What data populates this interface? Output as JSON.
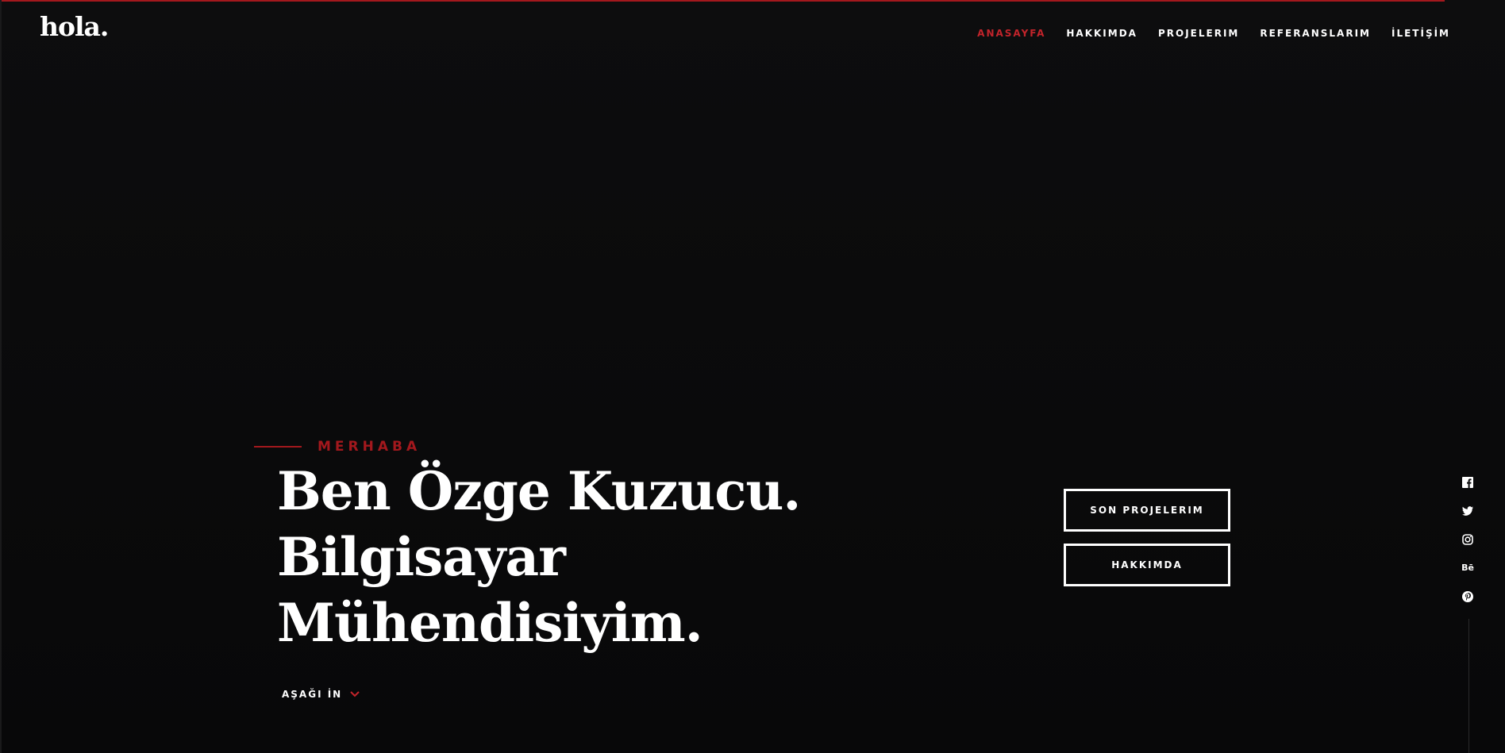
{
  "brand": {
    "logo_text": "hola."
  },
  "nav": {
    "items": [
      {
        "label": "ANASAYFA",
        "active": true
      },
      {
        "label": "HAKKIMDA",
        "active": false
      },
      {
        "label": "PROJELERIM",
        "active": false
      },
      {
        "label": "REFERANSLARIM",
        "active": false
      },
      {
        "label": "İLETİŞİM",
        "active": false
      }
    ]
  },
  "hero": {
    "intro": "MERHABA",
    "headline": "Ben Özge Kuzucu. Bilgisayar Mühendisiyim.",
    "buttons": {
      "projects": "SON PROJELERIM",
      "about": "HAKKIMDA"
    },
    "scroll_label": "AŞAĞI İN"
  },
  "social": {
    "icons": [
      "facebook-icon",
      "twitter-icon",
      "instagram-icon",
      "behance-icon",
      "pinterest-icon"
    ],
    "behance_glyph": "Bē"
  },
  "colors": {
    "accent": "#a3181d",
    "background": "#0b0b0c",
    "text": "#ffffff"
  }
}
